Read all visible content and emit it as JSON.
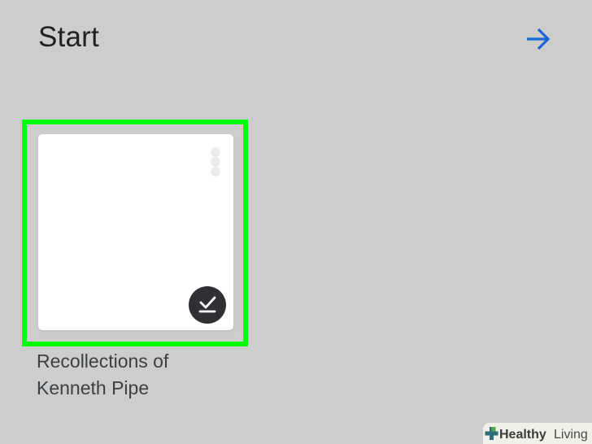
{
  "header": {
    "title": "Start",
    "forward_icon": "arrow-right-icon",
    "forward_color": "#1967d2"
  },
  "documents": [
    {
      "title": "Recollections of\nKenneth Pipe",
      "menu_icon": "more-vert-icon",
      "status_icon": "offline-available-icon",
      "highlighted": true
    }
  ],
  "colors": {
    "background": "#cdcdcd",
    "highlight": "#00ff00",
    "badge": "#2f3033"
  },
  "watermark": {
    "text_primary": "Healthy",
    "text_secondary": "Living"
  }
}
